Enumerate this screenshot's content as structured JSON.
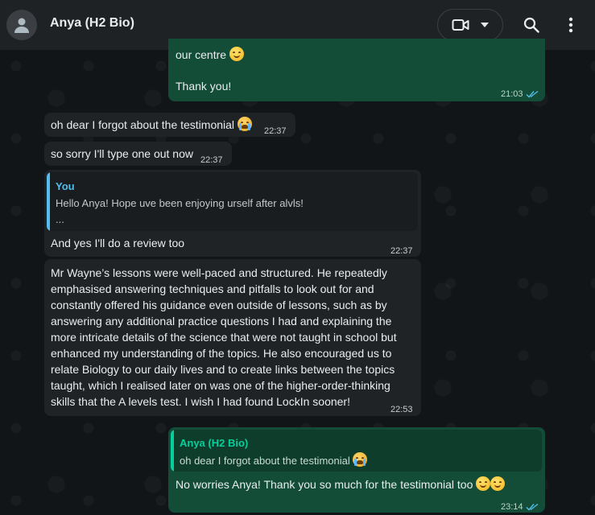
{
  "header": {
    "contact_name": "Anya (H2 Bio)",
    "icons": [
      "avatar-icon",
      "video-call-icon",
      "chevron-down-icon",
      "search-icon",
      "menu-icon"
    ]
  },
  "messages": [
    {
      "direction": "out",
      "lines": [
        "our centre"
      ],
      "emoji": "smile",
      "text2": "Thank you!",
      "time": "21:03",
      "read": true
    },
    {
      "direction": "in",
      "text": "oh dear I forgot about the testimonial",
      "emoji": "cry",
      "time": "22:37"
    },
    {
      "direction": "in",
      "text": "so sorry I'll type one out now",
      "time": "22:37"
    },
    {
      "direction": "in",
      "quote_author": "You",
      "quote_text": "Hello Anya! Hope uve been enjoying urself after alvls!",
      "quote_more": "...",
      "text": "And yes I'll do a review too",
      "time": "22:37"
    },
    {
      "direction": "in",
      "lines": [
        "Mr Wayne’s lessons were well-paced and structured. He repeatedly",
        "emphasised answering techniques and pitfalls to look out for and",
        "constantly offered his guidance even outside of lessons, such as by",
        "answering any additional practice questions I had and explaining the",
        "more intricate details of the science that were not taught in school but",
        "enhanced my understanding of the topics. He also encouraged us to",
        "relate Biology to our daily lives and to create links between the topics",
        "taught, which I realised later on was one of the higher-order-thinking",
        "skills that the A levels test. I wish I had found LockIn sooner!"
      ],
      "time": "22:53"
    },
    {
      "direction": "out",
      "quote_author": "Anya (H2 Bio)",
      "quote_text": "oh dear I forgot about the testimonial",
      "quote_emoji": "cry",
      "text": "No worries Anya! Thank you so much for the testimonial too",
      "emoji": "smile",
      "time": "23:14",
      "read": true
    }
  ],
  "colors": {
    "outgoing_bubble": "#144d37",
    "incoming_bubble": "#202326",
    "quote_you": "#53bdeb",
    "quote_contact": "#06cf9c",
    "read_tick": "#53bdeb"
  }
}
